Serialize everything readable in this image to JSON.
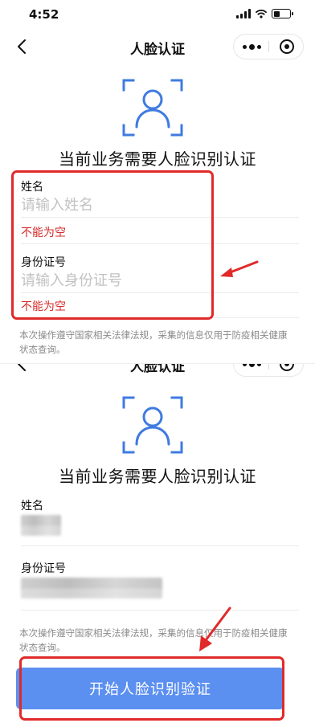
{
  "status_bar": {
    "time": "4:52"
  },
  "nav": {
    "title": "人脸认证"
  },
  "headline": "当前业务需要人脸识别认证",
  "form": {
    "name_label": "姓名",
    "name_placeholder": "请输入姓名",
    "name_error": "不能为空",
    "id_label": "身份证号",
    "id_placeholder": "请输入身份证号",
    "id_error": "不能为空"
  },
  "notice": "本次操作遵守国家相关法律法规，采集的信息仅用于防疫相关健康状态查询。",
  "start_button": "开始人脸识别验证",
  "colors": {
    "accent": "#5b8ff0",
    "icon_blue": "#3f7be0",
    "error": "#d42b2b",
    "annotation": "#e02a2a"
  },
  "icons": {
    "back": "chevron-left-icon",
    "more": "more-dots-icon",
    "close": "target-circle-icon",
    "face": "face-scan-icon"
  }
}
